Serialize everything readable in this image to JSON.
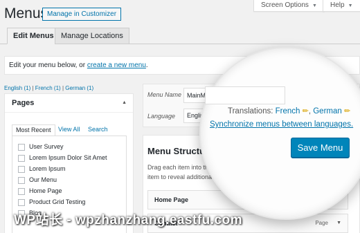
{
  "header": {
    "title": "Menus",
    "manage_customizer": "Manage in Customizer",
    "screen_options": "Screen Options",
    "help": "Help",
    "caret": "▼"
  },
  "tabs": {
    "edit_menus": "Edit Menus",
    "manage_locations": "Manage Locations"
  },
  "info": {
    "text": "Edit your menu below, or ",
    "link": "create a new menu",
    "suffix": "."
  },
  "languages": {
    "english": "English (1)",
    "french": "French (1)",
    "german": "German (1)",
    "sep": "|"
  },
  "pages_panel": {
    "title": "Pages",
    "tabs": {
      "most_recent": "Most Recent",
      "view_all": "View All",
      "search": "Search"
    },
    "items": [
      "User Survey",
      "Lorem Ipsum Dolor Sit Amet",
      "Lorem Ipsum",
      "Our Menu",
      "Home Page",
      "Product Grid Testing",
      "Blog"
    ]
  },
  "settings": {
    "menu_name_label": "Menu Name",
    "menu_name_value": "MainMe",
    "language_label": "Language",
    "language_value": "Englis"
  },
  "structure": {
    "title": "Menu Structure",
    "description": "Drag each item into the o... the item to reveal additiona...",
    "items": [
      {
        "title": "Home Page",
        "type": "Page"
      },
      {
        "title": "Contact",
        "type": "Page"
      }
    ]
  },
  "magnifier": {
    "translations_label": "Translations: ",
    "french": "French",
    "german": "German",
    "sync_link": "Synchronize menus between languages.",
    "save_button": "Save Menu",
    "pencil": "✏"
  },
  "watermark": "WP站长 - wpzhanzhang.eastfu.com",
  "colors": {
    "accent": "#0073aa",
    "primary_button": "#0085ba"
  }
}
